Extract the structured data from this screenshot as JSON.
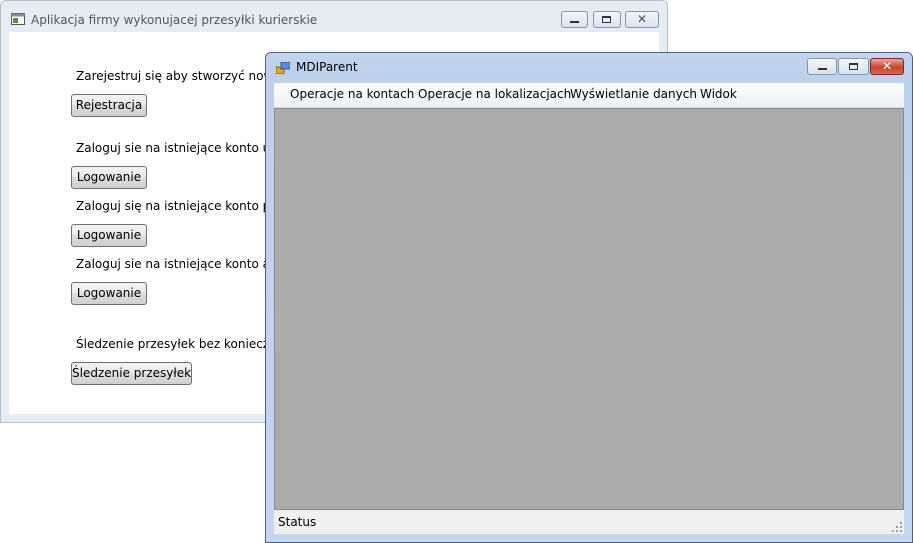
{
  "back_window": {
    "title": "Aplikacja firmy wykonujacej przesyłki kurierskie",
    "register_prompt": "Zarejestruj się aby stworzyć nowe ko",
    "register_button": "Rejestracja",
    "user_login_prompt": "Zaloguj sie na istniejące konto użytk",
    "user_login_button": "Logowanie",
    "employee_login_prompt": "Zaloguj się na istniejące konto praco",
    "employee_login_button": "Logowanie",
    "admin_login_prompt": "Zaloguj sie na istniejące konto admi",
    "admin_login_button": "Logowanie",
    "tracking_prompt": "Śledzenie przesyłek bez koniecznoś",
    "tracking_button": "Śledzenie przesyłek"
  },
  "front_window": {
    "title": "MDIParent",
    "menu": [
      {
        "label": "Operacje na kontach"
      },
      {
        "label": "Operacje na lokalizacjach"
      },
      {
        "label": "Wyświetlanie danych"
      },
      {
        "label": "Widok"
      }
    ],
    "status": "Status"
  },
  "colors": {
    "mdi_background": "#ababab",
    "title_bar_active": "#c2d4ed",
    "close_button": "#c8442f"
  }
}
